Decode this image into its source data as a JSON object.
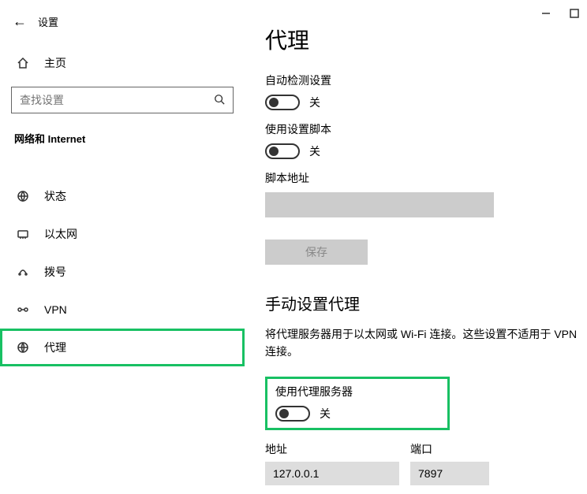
{
  "window": {
    "title": "设置"
  },
  "sidebar": {
    "home_label": "主页",
    "search_placeholder": "查找设置",
    "category_label": "网络和 Internet",
    "items": [
      {
        "label": "状态"
      },
      {
        "label": "以太网"
      },
      {
        "label": "拨号"
      },
      {
        "label": "VPN"
      },
      {
        "label": "代理"
      }
    ]
  },
  "content": {
    "page_title": "代理",
    "auto_detect": {
      "label": "自动检测设置",
      "state": "关"
    },
    "setup_script": {
      "label": "使用设置脚本",
      "state": "关"
    },
    "script_address_label": "脚本地址",
    "script_address_value": "",
    "save_label": "保存",
    "manual_section_title": "手动设置代理",
    "manual_section_desc": "将代理服务器用于以太网或 Wi-Fi 连接。这些设置不适用于 VPN 连接。",
    "use_proxy": {
      "label": "使用代理服务器",
      "state": "关"
    },
    "address_label": "地址",
    "address_value": "127.0.0.1",
    "port_label": "端口",
    "port_value": "7897"
  }
}
